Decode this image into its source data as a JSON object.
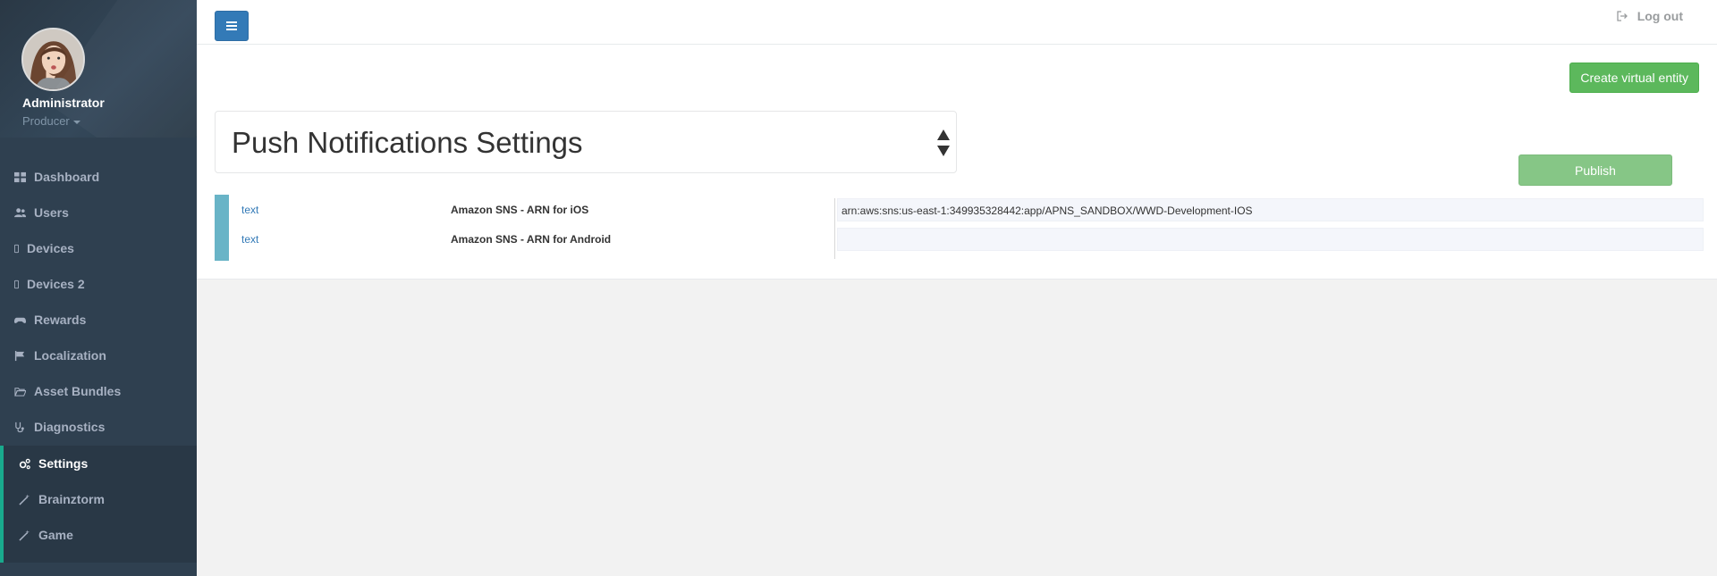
{
  "profile": {
    "name": "Administrator",
    "role": "Producer"
  },
  "sidebar": {
    "items": [
      {
        "label": "Dashboard",
        "icon": "dashboard-icon"
      },
      {
        "label": "Users",
        "icon": "users-icon"
      },
      {
        "label": "Devices",
        "icon": "mobile-icon"
      },
      {
        "label": "Devices 2",
        "icon": "mobile-icon"
      },
      {
        "label": "Rewards",
        "icon": "gamepad-icon"
      },
      {
        "label": "Localization",
        "icon": "flag-icon"
      },
      {
        "label": "Asset Bundles",
        "icon": "folder-open-icon"
      },
      {
        "label": "Diagnostics",
        "icon": "stethoscope-icon"
      },
      {
        "label": "Settings",
        "icon": "cogs-icon"
      },
      {
        "label": "Brainztorm",
        "icon": "magic-wand-icon"
      },
      {
        "label": "Game",
        "icon": "magic-wand-icon"
      }
    ],
    "active_item": "Settings"
  },
  "header": {
    "logout_label": "Log out"
  },
  "main": {
    "create_button_label": "Create virtual entity",
    "settings_select": {
      "selected": "Push Notifications Settings"
    },
    "publish_button_label": "Publish",
    "rows": [
      {
        "type": "text",
        "label": "Amazon SNS - ARN for iOS",
        "value": "arn:aws:sns:us-east-1:349935328442:app/APNS_SANDBOX/WWD-Development-IOS"
      },
      {
        "type": "text",
        "label": "Amazon SNS - ARN for Android",
        "value": ""
      }
    ]
  },
  "colors": {
    "sidebar_bg": "#2f4050",
    "active_accent": "#19aa8d",
    "primary": "#337ab7",
    "success": "#5cb85c",
    "publish_disabled": "#86c686",
    "row_stripe": "#69b4c7"
  }
}
